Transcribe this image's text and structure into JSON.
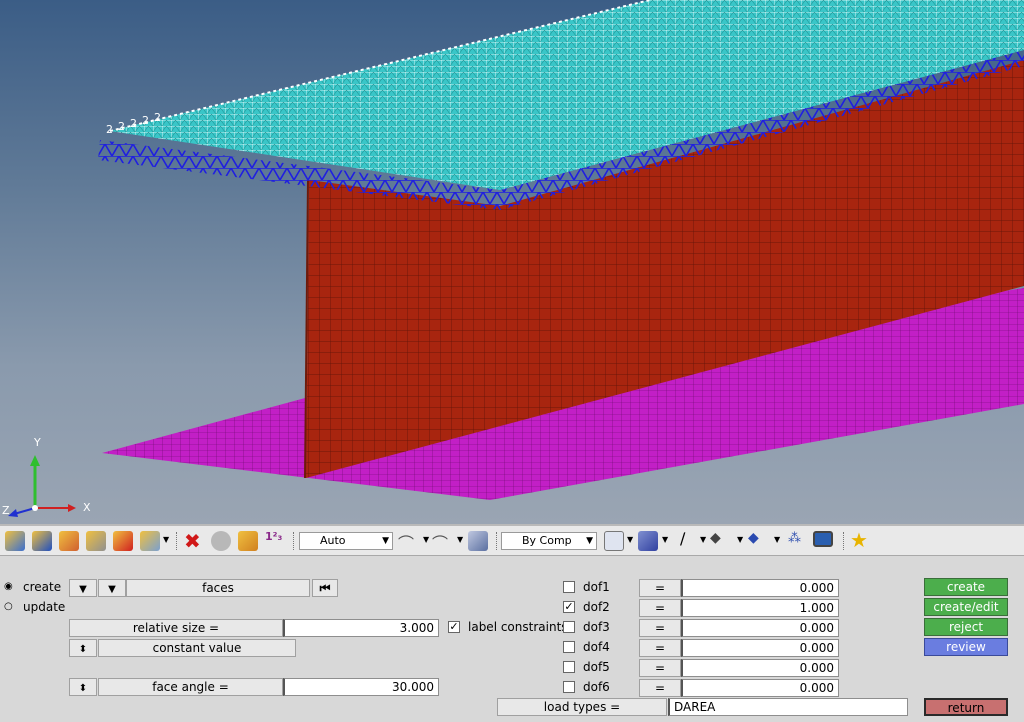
{
  "axes": {
    "x": "X",
    "y": "Y",
    "z": "Z"
  },
  "mesh_labels": {
    "constraint_digit": "2"
  },
  "colors": {
    "flange_top": "#39c6c8",
    "web": "#a8250f",
    "flange_bottom": "#c21fc6",
    "constraint_blue": "#1f1fe0",
    "button_green": "#4cae4c",
    "button_blue": "#6a7de0",
    "return_red": "#c87070"
  },
  "toolbar": {
    "left_icons": [
      "model-icon",
      "component-icon",
      "assembly-icon",
      "collector-icon",
      "import-icon",
      "select-icon"
    ],
    "delete_icons": [
      "delete-icon",
      "mask-icon",
      "find-icon",
      "numbering-icon"
    ],
    "display_dropdown": "Auto",
    "color_dropdown": "By Comp",
    "star_icon": "favorite-star-icon"
  },
  "panel": {
    "mode_options": {
      "create": "create",
      "update": "update"
    },
    "entity_selector": "faces",
    "relative_size_label": "relative size =",
    "relative_size_value": "3.000",
    "label_constraints": "label constraints",
    "constant_value": "constant value",
    "face_angle_label": "face angle =",
    "face_angle_value": "30.000",
    "dofs": [
      {
        "label": "dof1",
        "checked": false,
        "eq": "=",
        "value": "0.000"
      },
      {
        "label": "dof2",
        "checked": true,
        "eq": "=",
        "value": "1.000"
      },
      {
        "label": "dof3",
        "checked": false,
        "eq": "=",
        "value": "0.000"
      },
      {
        "label": "dof4",
        "checked": false,
        "eq": "=",
        "value": "0.000"
      },
      {
        "label": "dof5",
        "checked": false,
        "eq": "=",
        "value": "0.000"
      },
      {
        "label": "dof6",
        "checked": false,
        "eq": "=",
        "value": "0.000"
      }
    ],
    "load_types_label": "load types =",
    "load_types_value": "DAREA",
    "actions": {
      "create": "create",
      "create_edit": "create/edit",
      "reject": "reject",
      "review": "review",
      "return": "return"
    }
  }
}
